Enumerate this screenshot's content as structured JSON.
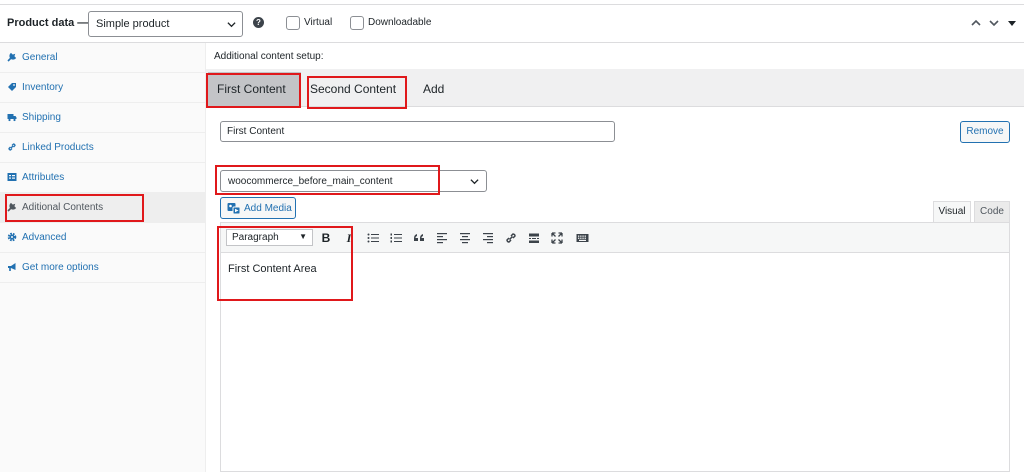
{
  "header": {
    "title": "Product data —",
    "product_type": "Simple product",
    "help_icon": "?",
    "virtual_label": "Virtual",
    "downloadable_label": "Downloadable"
  },
  "sidebar": {
    "items": [
      {
        "label": "General",
        "icon": "wrench-icon"
      },
      {
        "label": "Inventory",
        "icon": "tag-icon"
      },
      {
        "label": "Shipping",
        "icon": "truck-icon"
      },
      {
        "label": "Linked Products",
        "icon": "link-icon"
      },
      {
        "label": "Attributes",
        "icon": "list-icon"
      },
      {
        "label": "Aditional Contents",
        "icon": "wrench-icon",
        "active": true
      },
      {
        "label": "Advanced",
        "icon": "gear-icon"
      },
      {
        "label": "Get more options",
        "icon": "megaphone-icon"
      }
    ]
  },
  "main": {
    "section_label": "Additional content setup:",
    "tabs": [
      {
        "label": "First Content",
        "active": true
      },
      {
        "label": "Second Content"
      },
      {
        "label": "Add"
      }
    ],
    "content_title_value": "First Content",
    "remove_label": "Remove",
    "hook_select_value": "woocommerce_before_main_content",
    "add_media_label": "Add Media",
    "mode_visual": "Visual",
    "mode_code": "Code",
    "editor": {
      "format_value": "Paragraph",
      "bold": "B",
      "italic": "I",
      "body": "First Content Area"
    }
  },
  "colors": {
    "link": "#2271b1",
    "highlight": "#e0181b",
    "active_tab": "#c3c4c7"
  }
}
